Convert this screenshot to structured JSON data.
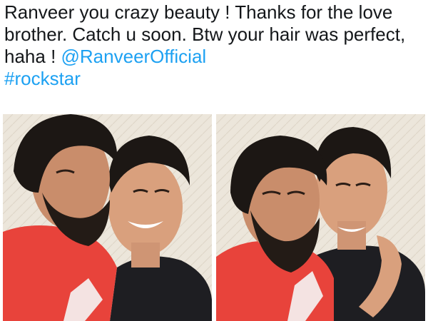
{
  "tweet": {
    "text_parts": [
      "Ranveer you crazy beauty ! Thanks for the love brother. Catch u soon. Btw your hair was perfect, haha ! ",
      "@RanveerOfficial",
      "\n",
      "#rockstar"
    ],
    "mention": "@RanveerOfficial",
    "hashtag": "#rockstar",
    "body": "Ranveer you crazy beauty ! Thanks for the love brother. Catch u soon. Btw your hair was perfect, haha ! ",
    "link_color": "#1da1f2",
    "text_color": "#14171a"
  },
  "media": {
    "photos": [
      {
        "subject": "selfie of two men, one bearded in red t-shirt kissing cheek of smiling man in black t-shirt"
      },
      {
        "subject": "selfie of two men, bearded man in red t-shirt and smiling man in black t-shirt with arm around him"
      }
    ],
    "colors": {
      "red_shirt": "#e8433b",
      "black_shirt": "#1e1e22",
      "skin": "#d9a07d",
      "hair": "#1c1714",
      "wall": "#e9e3d8"
    }
  }
}
